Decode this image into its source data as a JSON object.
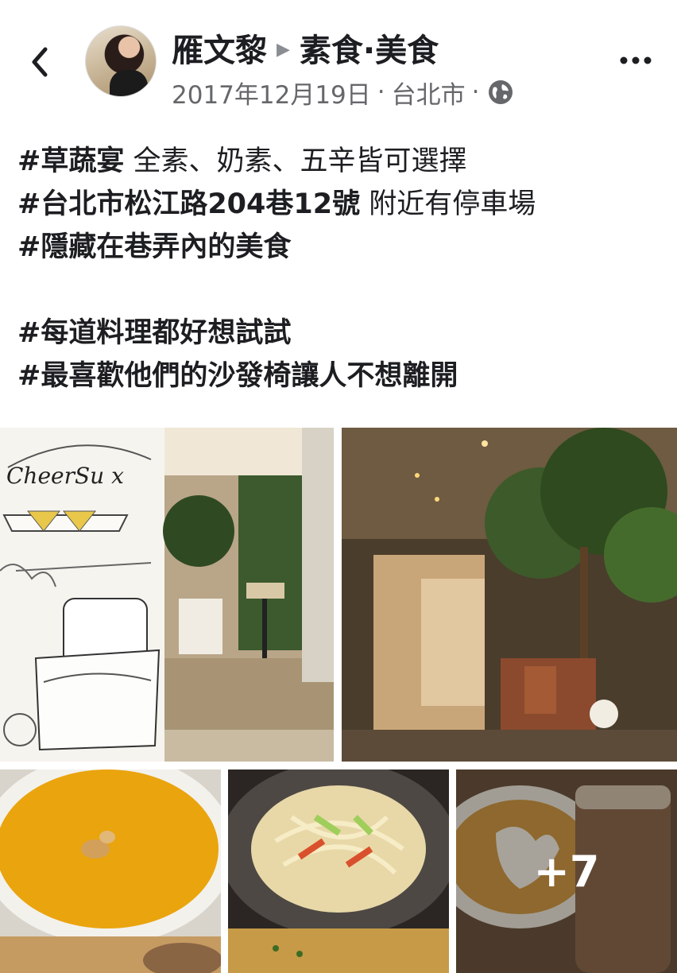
{
  "header": {
    "author": "雁文黎",
    "group": "素食·美食",
    "date": "2017年12月19日",
    "location": "台北市",
    "separator": "·"
  },
  "post": {
    "lines": [
      {
        "tag": "#草蔬宴",
        "text": " 全素、奶素、五辛皆可選擇"
      },
      {
        "tag": "#台北市松江路204巷12號",
        "text": " 附近有停車場"
      },
      {
        "tag": "#隱藏在巷弄內的美食",
        "text": ""
      },
      {
        "tag": "#每道料理都好想試試",
        "text": ""
      },
      {
        "tag": "#最喜歡他們的沙發椅讓人不想離開",
        "text": ""
      }
    ]
  },
  "photos": {
    "sign_text": "CheerSu x",
    "more_count": "+7"
  },
  "icons": {
    "back": "chevron-left-icon",
    "more": "more-horizontal-icon",
    "privacy": "globe-icon",
    "arrow": "caret-right-icon"
  },
  "colors": {
    "text_primary": "#1c1e21",
    "text_secondary": "#65676b"
  }
}
